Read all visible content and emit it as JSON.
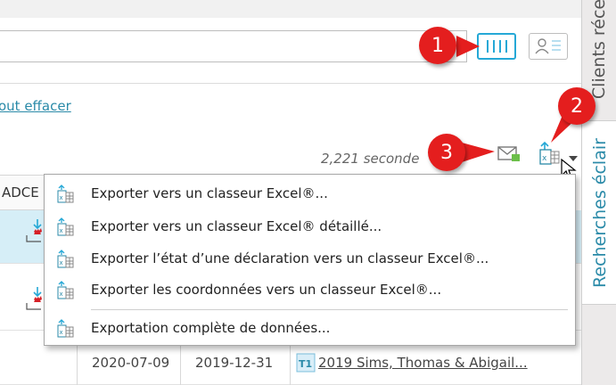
{
  "sidebar": {
    "tab_recent": "Clients réce",
    "tab_search": "Recherches éclair"
  },
  "search": {
    "value": "",
    "placeholder": ""
  },
  "view_toggle": {
    "columns_icon": "columns-view-icon",
    "cards_icon": "contact-card-icon"
  },
  "toolbar": {
    "clear_link": "out effacer",
    "timing": "2,221 seconde",
    "email_icon": "email-icon",
    "excel_icon": "excel-export-icon",
    "dropdown_icon": "dropdown-arrow-icon"
  },
  "grid": {
    "header": "ADCE",
    "rows": [
      {
        "icon": "download-leaf-icon"
      },
      {
        "icon": "download-leaf-icon"
      },
      {
        "date1": "2020-07-09",
        "date2": "2019-12-31",
        "file_icon": "t1-return-icon",
        "name": "2019 Sims, Thomas & Abigail..."
      }
    ]
  },
  "menu": {
    "items": [
      {
        "label": "Exporter vers un classeur Excel®...",
        "icon": "excel-file-icon"
      },
      {
        "label": "Exporter vers un classeur Excel® détaillé...",
        "icon": "excel-file-icon"
      },
      {
        "label": "Exporter l’état d’une déclaration vers un classeur Excel®...",
        "icon": "excel-file-icon"
      },
      {
        "label": "Exporter les coordonnées vers un classeur Excel®...",
        "icon": "excel-file-icon"
      },
      {
        "label": "Exportation complète de données...",
        "icon": "excel-file-icon"
      }
    ]
  },
  "callouts": [
    {
      "number": "1"
    },
    {
      "number": "2"
    },
    {
      "number": "3"
    }
  ],
  "colors": {
    "accent": "#25a8d6",
    "callout": "#e41e1e",
    "link": "#2a8aa8",
    "selected_row": "#d6eef7"
  }
}
